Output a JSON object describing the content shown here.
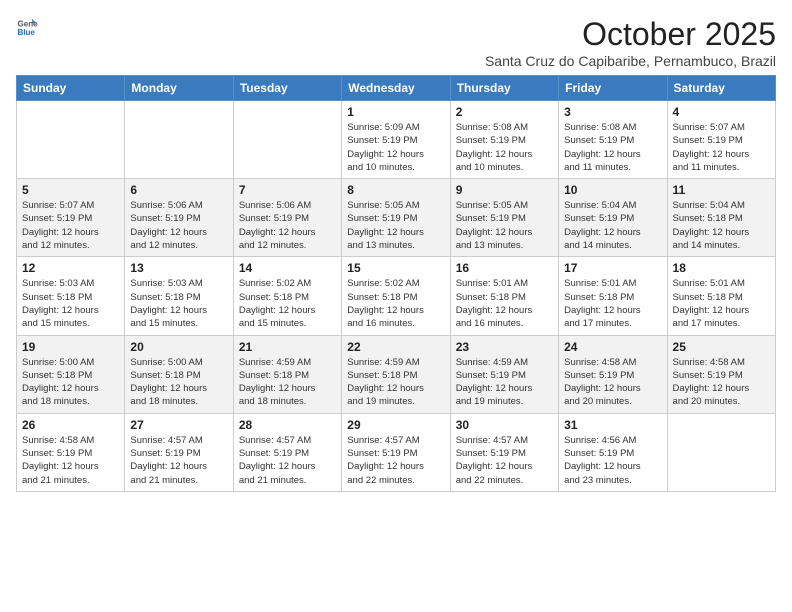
{
  "logo": {
    "general": "General",
    "blue": "Blue"
  },
  "header": {
    "month": "October 2025",
    "location": "Santa Cruz do Capibaribe, Pernambuco, Brazil"
  },
  "weekdays": [
    "Sunday",
    "Monday",
    "Tuesday",
    "Wednesday",
    "Thursday",
    "Friday",
    "Saturday"
  ],
  "weeks": [
    [
      {
        "day": "",
        "info": ""
      },
      {
        "day": "",
        "info": ""
      },
      {
        "day": "",
        "info": ""
      },
      {
        "day": "1",
        "info": "Sunrise: 5:09 AM\nSunset: 5:19 PM\nDaylight: 12 hours\nand 10 minutes."
      },
      {
        "day": "2",
        "info": "Sunrise: 5:08 AM\nSunset: 5:19 PM\nDaylight: 12 hours\nand 10 minutes."
      },
      {
        "day": "3",
        "info": "Sunrise: 5:08 AM\nSunset: 5:19 PM\nDaylight: 12 hours\nand 11 minutes."
      },
      {
        "day": "4",
        "info": "Sunrise: 5:07 AM\nSunset: 5:19 PM\nDaylight: 12 hours\nand 11 minutes."
      }
    ],
    [
      {
        "day": "5",
        "info": "Sunrise: 5:07 AM\nSunset: 5:19 PM\nDaylight: 12 hours\nand 12 minutes."
      },
      {
        "day": "6",
        "info": "Sunrise: 5:06 AM\nSunset: 5:19 PM\nDaylight: 12 hours\nand 12 minutes."
      },
      {
        "day": "7",
        "info": "Sunrise: 5:06 AM\nSunset: 5:19 PM\nDaylight: 12 hours\nand 12 minutes."
      },
      {
        "day": "8",
        "info": "Sunrise: 5:05 AM\nSunset: 5:19 PM\nDaylight: 12 hours\nand 13 minutes."
      },
      {
        "day": "9",
        "info": "Sunrise: 5:05 AM\nSunset: 5:19 PM\nDaylight: 12 hours\nand 13 minutes."
      },
      {
        "day": "10",
        "info": "Sunrise: 5:04 AM\nSunset: 5:19 PM\nDaylight: 12 hours\nand 14 minutes."
      },
      {
        "day": "11",
        "info": "Sunrise: 5:04 AM\nSunset: 5:18 PM\nDaylight: 12 hours\nand 14 minutes."
      }
    ],
    [
      {
        "day": "12",
        "info": "Sunrise: 5:03 AM\nSunset: 5:18 PM\nDaylight: 12 hours\nand 15 minutes."
      },
      {
        "day": "13",
        "info": "Sunrise: 5:03 AM\nSunset: 5:18 PM\nDaylight: 12 hours\nand 15 minutes."
      },
      {
        "day": "14",
        "info": "Sunrise: 5:02 AM\nSunset: 5:18 PM\nDaylight: 12 hours\nand 15 minutes."
      },
      {
        "day": "15",
        "info": "Sunrise: 5:02 AM\nSunset: 5:18 PM\nDaylight: 12 hours\nand 16 minutes."
      },
      {
        "day": "16",
        "info": "Sunrise: 5:01 AM\nSunset: 5:18 PM\nDaylight: 12 hours\nand 16 minutes."
      },
      {
        "day": "17",
        "info": "Sunrise: 5:01 AM\nSunset: 5:18 PM\nDaylight: 12 hours\nand 17 minutes."
      },
      {
        "day": "18",
        "info": "Sunrise: 5:01 AM\nSunset: 5:18 PM\nDaylight: 12 hours\nand 17 minutes."
      }
    ],
    [
      {
        "day": "19",
        "info": "Sunrise: 5:00 AM\nSunset: 5:18 PM\nDaylight: 12 hours\nand 18 minutes."
      },
      {
        "day": "20",
        "info": "Sunrise: 5:00 AM\nSunset: 5:18 PM\nDaylight: 12 hours\nand 18 minutes."
      },
      {
        "day": "21",
        "info": "Sunrise: 4:59 AM\nSunset: 5:18 PM\nDaylight: 12 hours\nand 18 minutes."
      },
      {
        "day": "22",
        "info": "Sunrise: 4:59 AM\nSunset: 5:18 PM\nDaylight: 12 hours\nand 19 minutes."
      },
      {
        "day": "23",
        "info": "Sunrise: 4:59 AM\nSunset: 5:19 PM\nDaylight: 12 hours\nand 19 minutes."
      },
      {
        "day": "24",
        "info": "Sunrise: 4:58 AM\nSunset: 5:19 PM\nDaylight: 12 hours\nand 20 minutes."
      },
      {
        "day": "25",
        "info": "Sunrise: 4:58 AM\nSunset: 5:19 PM\nDaylight: 12 hours\nand 20 minutes."
      }
    ],
    [
      {
        "day": "26",
        "info": "Sunrise: 4:58 AM\nSunset: 5:19 PM\nDaylight: 12 hours\nand 21 minutes."
      },
      {
        "day": "27",
        "info": "Sunrise: 4:57 AM\nSunset: 5:19 PM\nDaylight: 12 hours\nand 21 minutes."
      },
      {
        "day": "28",
        "info": "Sunrise: 4:57 AM\nSunset: 5:19 PM\nDaylight: 12 hours\nand 21 minutes."
      },
      {
        "day": "29",
        "info": "Sunrise: 4:57 AM\nSunset: 5:19 PM\nDaylight: 12 hours\nand 22 minutes."
      },
      {
        "day": "30",
        "info": "Sunrise: 4:57 AM\nSunset: 5:19 PM\nDaylight: 12 hours\nand 22 minutes."
      },
      {
        "day": "31",
        "info": "Sunrise: 4:56 AM\nSunset: 5:19 PM\nDaylight: 12 hours\nand 23 minutes."
      },
      {
        "day": "",
        "info": ""
      }
    ]
  ]
}
